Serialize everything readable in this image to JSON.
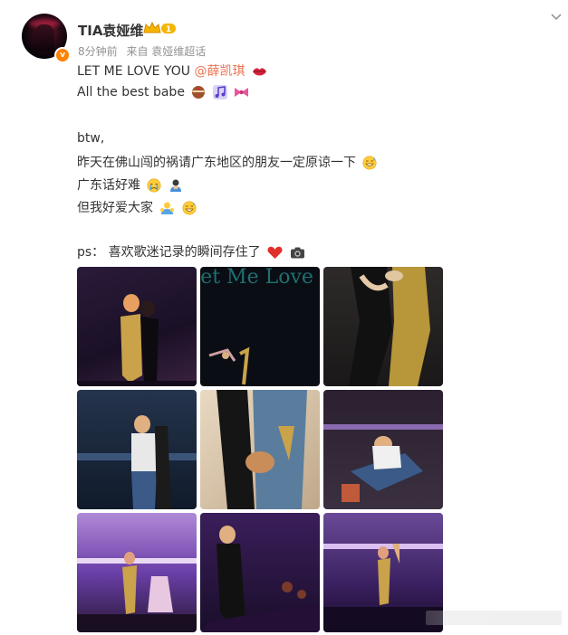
{
  "post": {
    "username": "TIA袁娅维",
    "time": "8分钟前",
    "source": "来自 袁娅维超话",
    "verified": "v",
    "lines": [
      {
        "text": "LET ME LOVE YOU ",
        "mention": "@薛凯琪"
      },
      {
        "text": "All the best babe"
      },
      {
        "text": "btw,"
      },
      {
        "text": "昨天在佛山闯的祸请广东地区的朋友一定原谅一下"
      },
      {
        "text": "广东话好难"
      },
      {
        "text": "但我好爱大家"
      },
      {
        "text": "ps： 喜欢歌迷记录的瞬间存住了"
      }
    ],
    "photo_text": "Let Me Love Y"
  },
  "icons": [
    "crown-icon",
    "chevron-down-icon",
    "lips-icon",
    "cake-icon",
    "music-icon",
    "bow-icon",
    "grin-sweat-icon",
    "crying-icon",
    "bowing-icon",
    "hug-icon",
    "heart-icon",
    "camera-icon"
  ],
  "colors": {
    "mention": "#eb7350",
    "text": "#333333",
    "meta": "#939393",
    "badge": "#ff8200"
  }
}
